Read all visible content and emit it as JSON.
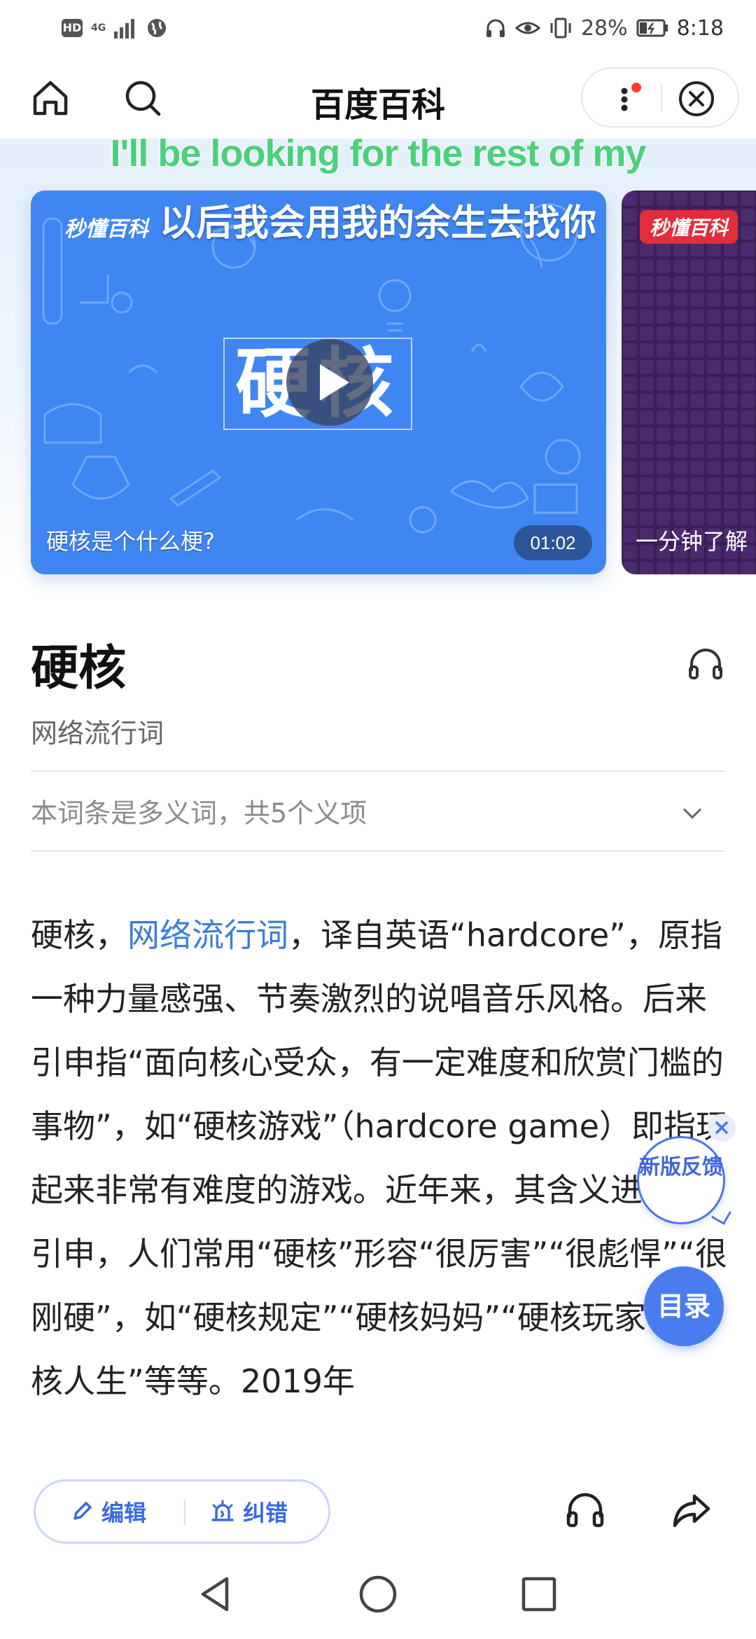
{
  "status_bar": {
    "network": "4G",
    "battery": "28%",
    "time": "8:18"
  },
  "header": {
    "title": "百度百科"
  },
  "video": {
    "subtitle_en": "I'll be looking for the rest of my",
    "subtitle_zh": "以后我会用我的余生去找你",
    "brand": "秒懂百科",
    "big_title": "硬核",
    "caption": "硬核是个什么梗?",
    "duration": "01:02",
    "second_brand": "秒懂百科",
    "second_caption": "一分钟了解"
  },
  "entry": {
    "title": "硬核",
    "subtitle": "网络流行词",
    "polysemy": "本词条是多义词，共5个义项"
  },
  "body": {
    "part1": "硬核，",
    "link": "网络流行词",
    "part2": "，译自英语“hardcore”，原指一种力量感强、节奏激烈的说唱音乐风格。后来引申指“面向核心受众，有一定难度和欣赏门槛的事物”，如“硬核游戏”（hardcore game）即指玩起来非常有难度的游戏。近年来，其含义进一步引申，人们常用“硬核”形容“很厉害”“很彪悍”“很刚硬”，如“硬核规定”“硬核妈妈”“硬核玩家”“硬核人生”等等。2019年"
  },
  "floating": {
    "feedback": "新版反馈",
    "toc": "目录"
  },
  "toolbar": {
    "edit": "编辑",
    "correct": "纠错"
  }
}
